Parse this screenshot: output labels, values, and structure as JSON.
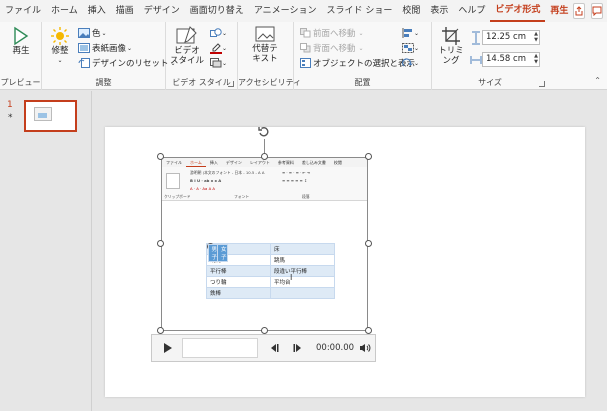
{
  "menu": {
    "tabs": [
      "ファイル",
      "ホーム",
      "挿入",
      "描画",
      "デザイン",
      "画面切り替え",
      "アニメーション",
      "スライド ショー",
      "校閲",
      "表示",
      "ヘルプ"
    ],
    "context_tab": "ビデオ形式",
    "playback_tab": "再生"
  },
  "ribbon": {
    "preview": {
      "play_label": "再生",
      "group": "プレビュー"
    },
    "adjust": {
      "correct_label": "修整",
      "color_label": "色",
      "poster_label": "表紙画像",
      "reset_label": "デザインのリセット",
      "group": "調整"
    },
    "video_styles": {
      "styles_label_1": "ビデオ",
      "styles_label_2": "スタイル",
      "group": "ビデオ スタイル"
    },
    "accessibility": {
      "alt_text_1": "代替テ",
      "alt_text_2": "キスト",
      "group": "アクセシビリティ"
    },
    "arrange": {
      "bring_forward": "前面へ移動",
      "send_backward": "背面へ移動",
      "selection_pane": "オブジェクトの選択と表示",
      "group": "配置"
    },
    "size": {
      "crop_label": "トリミング",
      "height": "12.25 cm",
      "width": "14.58 cm",
      "group": "サイズ"
    }
  },
  "thumbnail": {
    "number": "1",
    "star": "*"
  },
  "video_doc": {
    "menu": [
      "ファイル",
      "ホーム",
      "挿入",
      "デザイン",
      "レイアウト",
      "参考資料",
      "差し込み文書",
      "校閲"
    ],
    "font_line": "游明朝 (本文のフォント - 日本 - 10.5 - A A",
    "groups": [
      "クリップボード",
      "フォント",
      "段落"
    ],
    "table": {
      "header": [
        "男子",
        "女子"
      ],
      "rows": [
        [
          "床",
          "床"
        ],
        [
          "跳馬",
          "跳馬"
        ],
        [
          "平行棒",
          "段違い平行棒"
        ],
        [
          "つり輪",
          "平均台"
        ],
        [
          "鉄棒",
          ""
        ]
      ]
    }
  },
  "player": {
    "time": "00:00.00"
  }
}
